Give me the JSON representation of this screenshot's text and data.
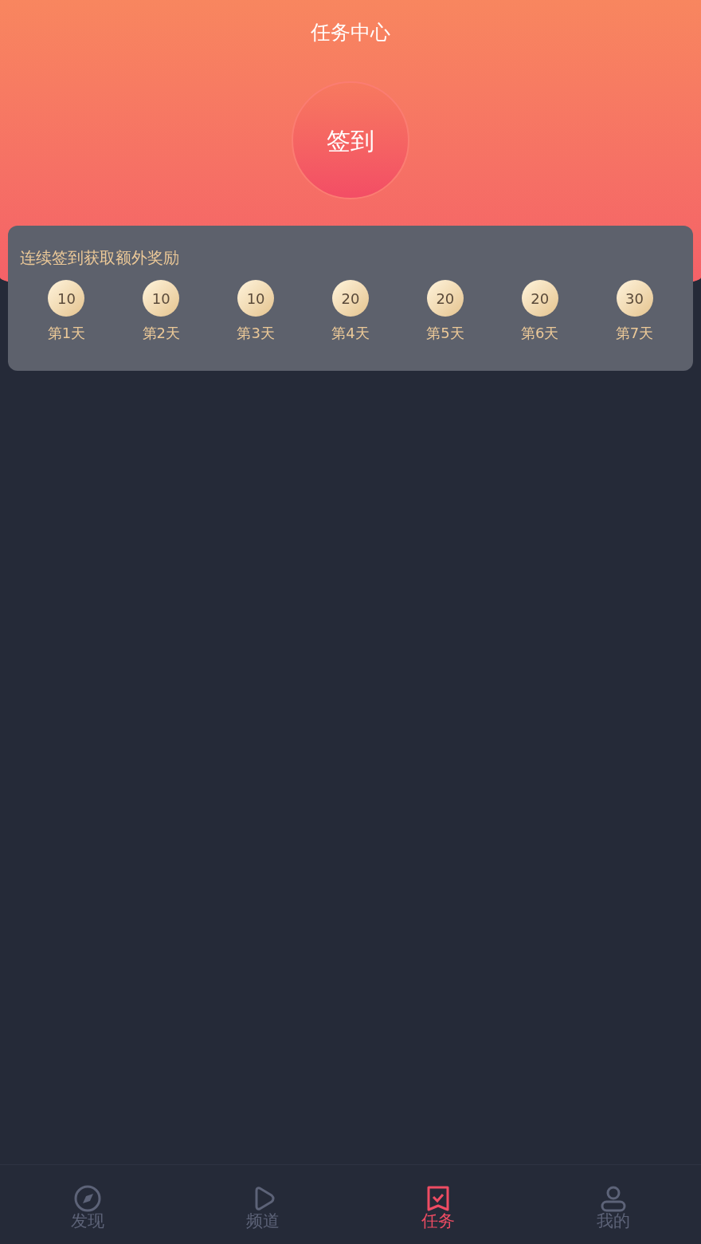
{
  "header": {
    "title": "任务中心"
  },
  "checkin_button": {
    "label": "签到"
  },
  "rewards": {
    "title": "连续签到获取额外奖励",
    "days": [
      {
        "points": "10",
        "label": "第1天"
      },
      {
        "points": "10",
        "label": "第2天"
      },
      {
        "points": "10",
        "label": "第3天"
      },
      {
        "points": "20",
        "label": "第4天"
      },
      {
        "points": "20",
        "label": "第5天"
      },
      {
        "points": "20",
        "label": "第6天"
      },
      {
        "points": "30",
        "label": "第7天"
      }
    ]
  },
  "tabs": [
    {
      "kind": "discover",
      "label": "发现",
      "selected": false
    },
    {
      "kind": "channel",
      "label": "频道",
      "selected": false
    },
    {
      "kind": "task",
      "label": "任务",
      "selected": true
    },
    {
      "kind": "me",
      "label": "我的",
      "selected": false
    }
  ]
}
